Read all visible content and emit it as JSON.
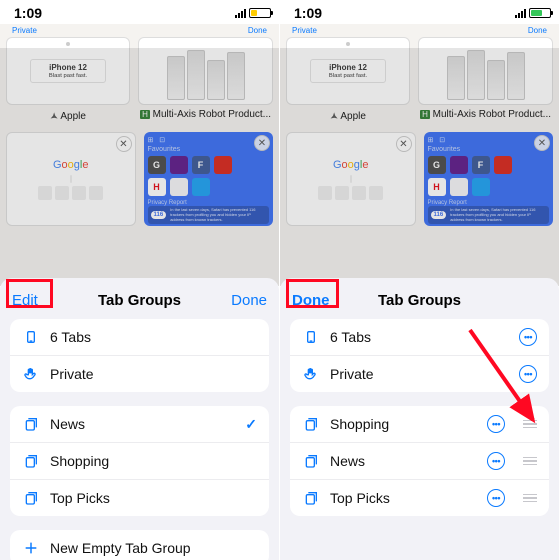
{
  "status": {
    "time": "1:09"
  },
  "thumbs": {
    "apple_label": "Apple",
    "robot_label": "Multi-Axis Robot Product...",
    "iphone_title": "iPhone 12",
    "iphone_sub": "Blast past fast.",
    "favourites": "Favourites",
    "privacy_title": "Privacy Report",
    "privacy_body": "In the last seven days, Safari has prevented 116 trackers from profiling you and hidden your IP address from known trackers.",
    "privacy_count": "116",
    "robot_favicon": "H",
    "tb_left": "Private",
    "tb_right": "Done"
  },
  "sheet": {
    "title": "Tab Groups",
    "edit": "Edit",
    "done": "Done"
  },
  "left": {
    "tabs": "6 Tabs",
    "private": "Private",
    "news": "News",
    "shopping": "Shopping",
    "toppicks": "Top Picks",
    "new_group": "New Empty Tab Group"
  },
  "right": {
    "tabs": "6 Tabs",
    "private": "Private",
    "shopping": "Shopping",
    "news": "News",
    "toppicks": "Top Picks"
  },
  "colors": {
    "accent": "#0a7aff",
    "highlight": "#ff0822",
    "battery_low": "#ffcc00",
    "battery_ok": "#34c759"
  },
  "fav_icons": [
    {
      "bg": "#4a4a4a",
      "fg": "#fff",
      "t": "G"
    },
    {
      "bg": "#5e1b8a",
      "fg": "#fff",
      "t": ""
    },
    {
      "bg": "#3b5998",
      "fg": "#fff",
      "t": "F"
    },
    {
      "bg": "#d9261c",
      "fg": "#fff",
      "t": ""
    },
    {
      "bg": "#ffffff",
      "fg": "#e50914",
      "t": "H"
    },
    {
      "bg": "#f5f5f7",
      "fg": "#111",
      "t": ""
    },
    {
      "bg": "#1da1f2",
      "fg": "#fff",
      "t": ""
    },
    {
      "bg": "transparent",
      "fg": "",
      "t": ""
    }
  ]
}
